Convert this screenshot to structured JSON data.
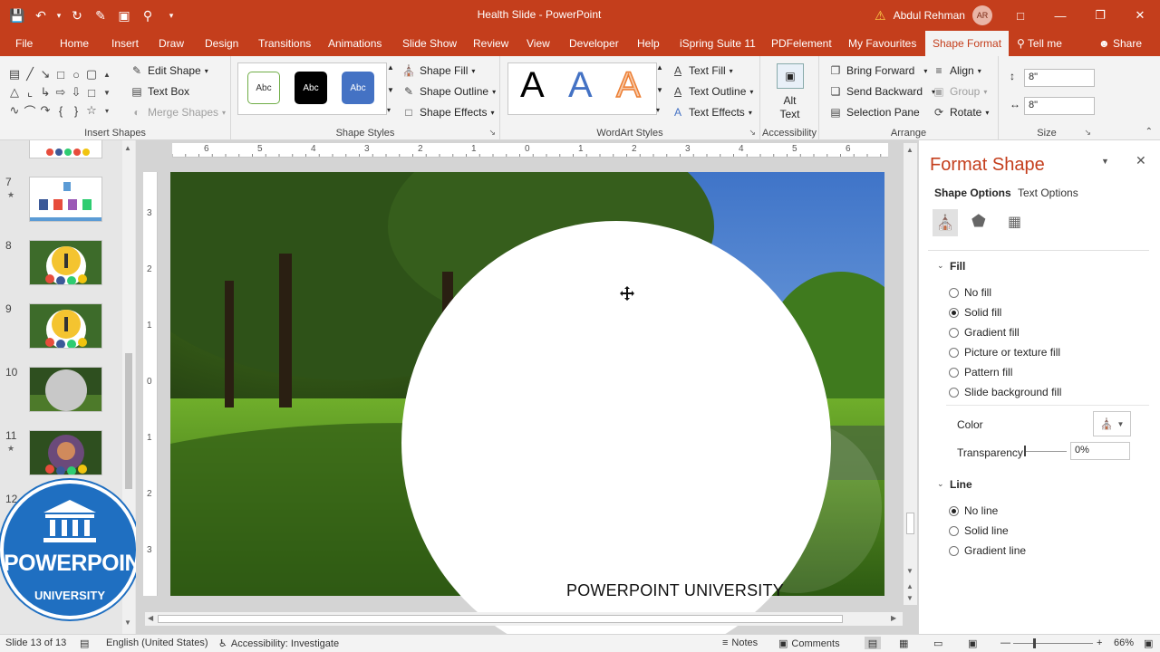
{
  "window": {
    "title": "Health Slide  -  PowerPoint",
    "user_name": "Abdul Rehman",
    "user_initials": "AR"
  },
  "tabs": [
    {
      "label": "File"
    },
    {
      "label": "Home"
    },
    {
      "label": "Insert"
    },
    {
      "label": "Draw"
    },
    {
      "label": "Design"
    },
    {
      "label": "Transitions"
    },
    {
      "label": "Animations"
    },
    {
      "label": "Slide Show"
    },
    {
      "label": "Review"
    },
    {
      "label": "View"
    },
    {
      "label": "Developer"
    },
    {
      "label": "Help"
    },
    {
      "label": "iSpring Suite 11"
    },
    {
      "label": "PDFelement"
    },
    {
      "label": "My Favourites"
    },
    {
      "label": "Shape Format"
    }
  ],
  "tell_me": "Tell me",
  "share": "Share",
  "ribbon": {
    "insert_shapes": {
      "label": "Insert Shapes",
      "edit_shape": "Edit Shape",
      "text_box": "Text Box",
      "merge_shapes": "Merge Shapes"
    },
    "shape_styles": {
      "label": "Shape Styles",
      "sample": "Abc",
      "shape_fill": "Shape Fill",
      "shape_outline": "Shape Outline",
      "shape_effects": "Shape Effects"
    },
    "wordart_styles": {
      "label": "WordArt Styles",
      "letter": "A",
      "text_fill": "Text Fill",
      "text_outline": "Text Outline",
      "text_effects": "Text Effects"
    },
    "accessibility": {
      "label": "Accessibility",
      "alt_text_1": "Alt",
      "alt_text_2": "Text"
    },
    "arrange": {
      "label": "Arrange",
      "bring_forward": "Bring Forward",
      "send_backward": "Send Backward",
      "selection_pane": "Selection Pane",
      "align": "Align",
      "group": "Group",
      "rotate": "Rotate"
    },
    "size": {
      "label": "Size",
      "height": "8\"",
      "width": "8\""
    }
  },
  "thumbnails": [
    {
      "number": "7",
      "starred": true
    },
    {
      "number": "8",
      "starred": false
    },
    {
      "number": "9",
      "starred": false
    },
    {
      "number": "10",
      "starred": false
    },
    {
      "number": "11",
      "starred": true
    },
    {
      "number": "12",
      "starred": false
    }
  ],
  "logo": {
    "line1": "POWERPOINT",
    "line2": "UNIVERSITY"
  },
  "slide": {
    "caption": "POWERPOINT UNIVERSITY"
  },
  "ruler": {
    "h_ticks": [
      "6",
      "5",
      "4",
      "3",
      "2",
      "1",
      "0",
      "1",
      "2",
      "3",
      "4",
      "5",
      "6"
    ],
    "v_ticks": [
      "3",
      "2",
      "1",
      "0",
      "1",
      "2",
      "3"
    ]
  },
  "format_pane": {
    "title": "Format Shape",
    "shape_options": "Shape Options",
    "text_options": "Text Options",
    "fill_section": "Fill",
    "fill_options": [
      "No fill",
      "Solid fill",
      "Gradient fill",
      "Picture or texture fill",
      "Pattern fill",
      "Slide background fill"
    ],
    "fill_selected": 1,
    "color_label": "Color",
    "transparency_label": "Transparency",
    "transparency_value": "0%",
    "line_section": "Line",
    "line_options": [
      "No line",
      "Solid line",
      "Gradient line"
    ],
    "line_selected": 0
  },
  "status": {
    "slide_info": "Slide 13 of 13",
    "language": "English (United States)",
    "accessibility": "Accessibility: Investigate",
    "notes": "Notes",
    "comments": "Comments",
    "zoom": "66%"
  },
  "colors": {
    "accent": "#c43e1c",
    "style_blue": "#4472c4"
  }
}
